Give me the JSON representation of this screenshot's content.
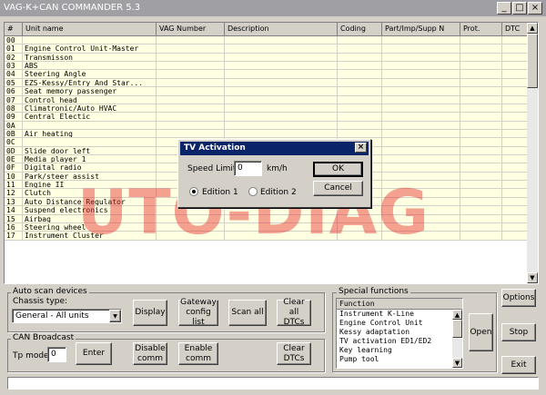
{
  "window": {
    "title": "VAG-K+CAN COMMANDER 5.3",
    "min_glyph": "_",
    "max_glyph": "□",
    "close_glyph": "×"
  },
  "grid": {
    "columns": [
      "#",
      "Unit name",
      "VAG Number",
      "Description",
      "Coding",
      "Part/Imp/Supp N",
      "Prot.",
      "DTC"
    ],
    "rows": [
      [
        "00",
        ""
      ],
      [
        "01",
        "Engine Control Unit-Master"
      ],
      [
        "02",
        "Transmisson"
      ],
      [
        "03",
        "ABS"
      ],
      [
        "04",
        "Steering Angle"
      ],
      [
        "05",
        "EZS-Kessy/Entry And Star..."
      ],
      [
        "06",
        "Seat memory passenger"
      ],
      [
        "07",
        "Control head"
      ],
      [
        "08",
        "Climatronic/Auto HVAC"
      ],
      [
        "09",
        "Central Electic"
      ],
      [
        "0A",
        ""
      ],
      [
        "0B",
        "Air heating"
      ],
      [
        "0C",
        ""
      ],
      [
        "0D",
        "Slide door left"
      ],
      [
        "0E",
        "Media player 1"
      ],
      [
        "0F",
        "Digital radio"
      ],
      [
        "10",
        "Park/steer assist"
      ],
      [
        "11",
        "Engine II"
      ],
      [
        "12",
        "Clutch"
      ],
      [
        "13",
        "Auto Distance Regulator"
      ],
      [
        "14",
        "Suspend electronics"
      ],
      [
        "15",
        "Airbag"
      ],
      [
        "16",
        "Steering wheel"
      ],
      [
        "17",
        "Instrument Cluster"
      ]
    ],
    "scroll_up": "▲",
    "scroll_down": "▼"
  },
  "watermark": "UTO-DIAG",
  "dialog": {
    "title": "TV Activation",
    "close": "×",
    "speed_label": "Speed Limit:",
    "speed_value": "0",
    "speed_unit": "km/h",
    "edition1": "Edition 1",
    "edition2": "Edition 2",
    "selected_edition": "Edition 1",
    "ok": "OK",
    "cancel": "Cancel"
  },
  "auto_scan": {
    "title": "Auto scan devices",
    "chassis_label": "Chassis type:",
    "chassis_value": "General - All units",
    "display": "Display",
    "gateway": "Gateway config list",
    "scan_all": "Scan all",
    "clear_all": "Clear all DTCs"
  },
  "can_broadcast": {
    "title": "CAN Broadcast",
    "tp_label": "Tp mode",
    "tp_value": "0",
    "enter": "Enter",
    "disable": "Disable comm",
    "enable": "Enable comm",
    "clear": "Clear DTCs"
  },
  "special": {
    "title": "Special functions",
    "header": "Function",
    "items": [
      "Instrument K-Line",
      "Engine Control Unit",
      "Kessy adaptation",
      "TV activation ED1/ED2",
      "Key learning",
      "Pump tool"
    ],
    "open": "Open"
  },
  "side": {
    "options": "Options",
    "stop": "Stop",
    "exit": "Exit"
  }
}
